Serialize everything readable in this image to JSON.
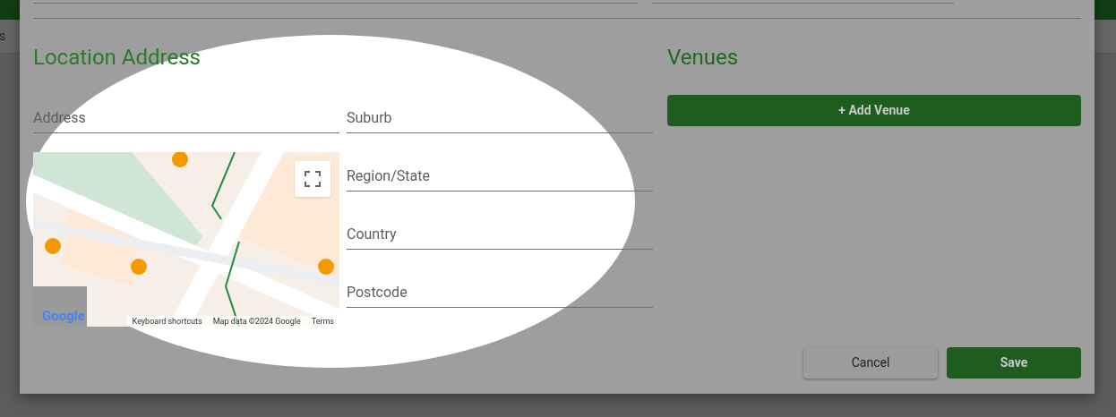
{
  "background": {
    "tab_fragment": "s"
  },
  "location": {
    "title": "Location Address",
    "fields": [
      {
        "placeholder": "Address"
      },
      {
        "placeholder": "Suburb"
      },
      {
        "placeholder": "Region/State"
      },
      {
        "placeholder": "Country"
      },
      {
        "placeholder": "Postcode"
      }
    ],
    "map": {
      "logo": "Google",
      "attribution": [
        "Keyboard shortcuts",
        "Map data ©2024 Google",
        "Terms"
      ]
    }
  },
  "venues": {
    "title": "Venues",
    "add_button": "+ Add Venue"
  },
  "buttons": [
    {
      "label": "Cancel",
      "kind": "secondary"
    },
    {
      "label": "Save",
      "kind": "primary"
    }
  ]
}
